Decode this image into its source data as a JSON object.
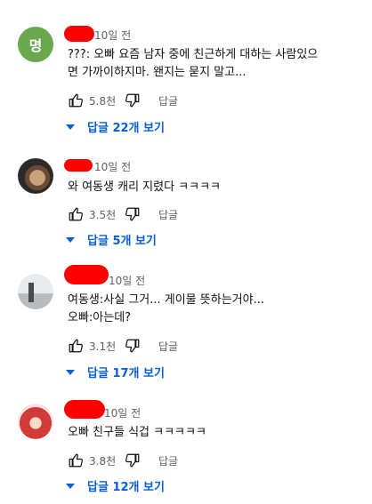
{
  "comments": [
    {
      "avatar_letter": "명",
      "time": "10일 전",
      "text": "???: 오빠 요즘 남자 중에 친근하게 대하는 사람있으\n면 가까이하지마. 왠지는 묻지 말고...",
      "likes": "5.8천",
      "reply_label": "답글",
      "replies_label": "답글 22개 보기"
    },
    {
      "time": "10일 전",
      "text": "와 여동생 캐리 지렸다 ㅋㅋㅋㅋ",
      "likes": "3.5천",
      "reply_label": "답글",
      "replies_label": "답글 5개 보기"
    },
    {
      "time": "10일 전",
      "text": "여동생:사실 그거... 게이물 뜻하는거야...\n오빠:아는데?",
      "likes": "3.1천",
      "reply_label": "답글",
      "replies_label": "답글 17개 보기"
    },
    {
      "time": "10일 전",
      "text": "오빠 친구들 식겁 ㅋㅋㅋㅋㅋ",
      "likes": "3.8천",
      "reply_label": "답글",
      "replies_label": "답글 12개 보기"
    }
  ],
  "colors": {
    "redaction": "#ff0000",
    "link_blue": "#065fd4",
    "meta_gray": "#606060"
  },
  "icons": {
    "like": "thumbs-up-icon",
    "dislike": "thumbs-down-icon",
    "expand": "chevron-down-icon"
  }
}
